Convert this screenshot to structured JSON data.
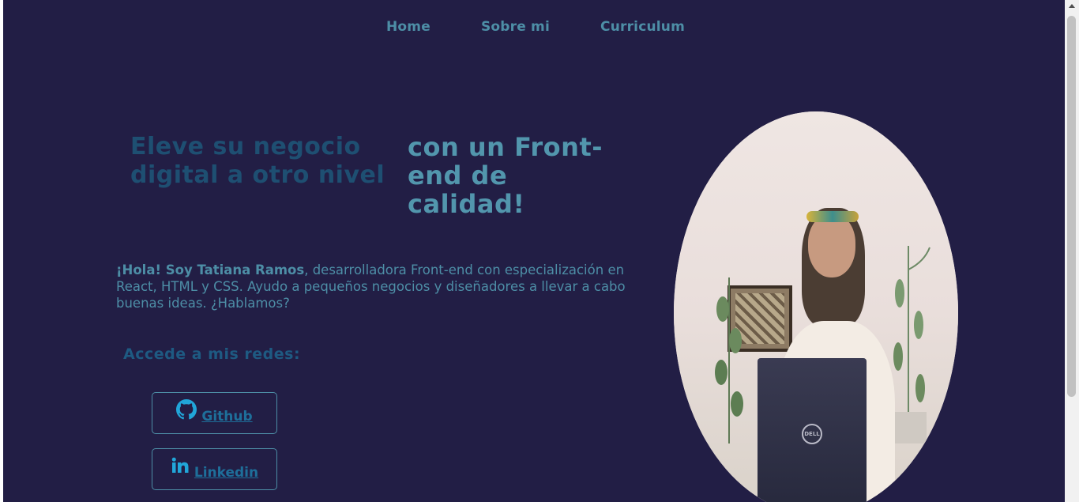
{
  "nav": {
    "items": [
      {
        "label": "Home"
      },
      {
        "label": "Sobre mi"
      },
      {
        "label": "Curriculum"
      }
    ]
  },
  "hero": {
    "headline_left": "Eleve su negocio digital a otro nivel",
    "headline_right": "con un Front-end de calidad!",
    "intro_bold": "¡Hola! Soy Tatiana Ramos",
    "intro_rest": ", desarrolladora Front-end con especialización en React, HTML y CSS. Ayudo a pequeños negocios y diseñadores a llevar a cabo buenas ideas. ¿Hablamos?"
  },
  "social": {
    "title": "Accede a mis redes:",
    "buttons": [
      {
        "label": "Github",
        "icon": "github-icon"
      },
      {
        "label": "Linkedin",
        "icon": "linkedin-icon"
      }
    ]
  },
  "photo": {
    "laptop_logo": "DELL"
  },
  "colors": {
    "background": "#221e45",
    "nav_text": "#4d8ea6",
    "headline_left": "#1e4f72",
    "headline_right": "#5296ad",
    "icon_accent": "#21a6d9"
  }
}
